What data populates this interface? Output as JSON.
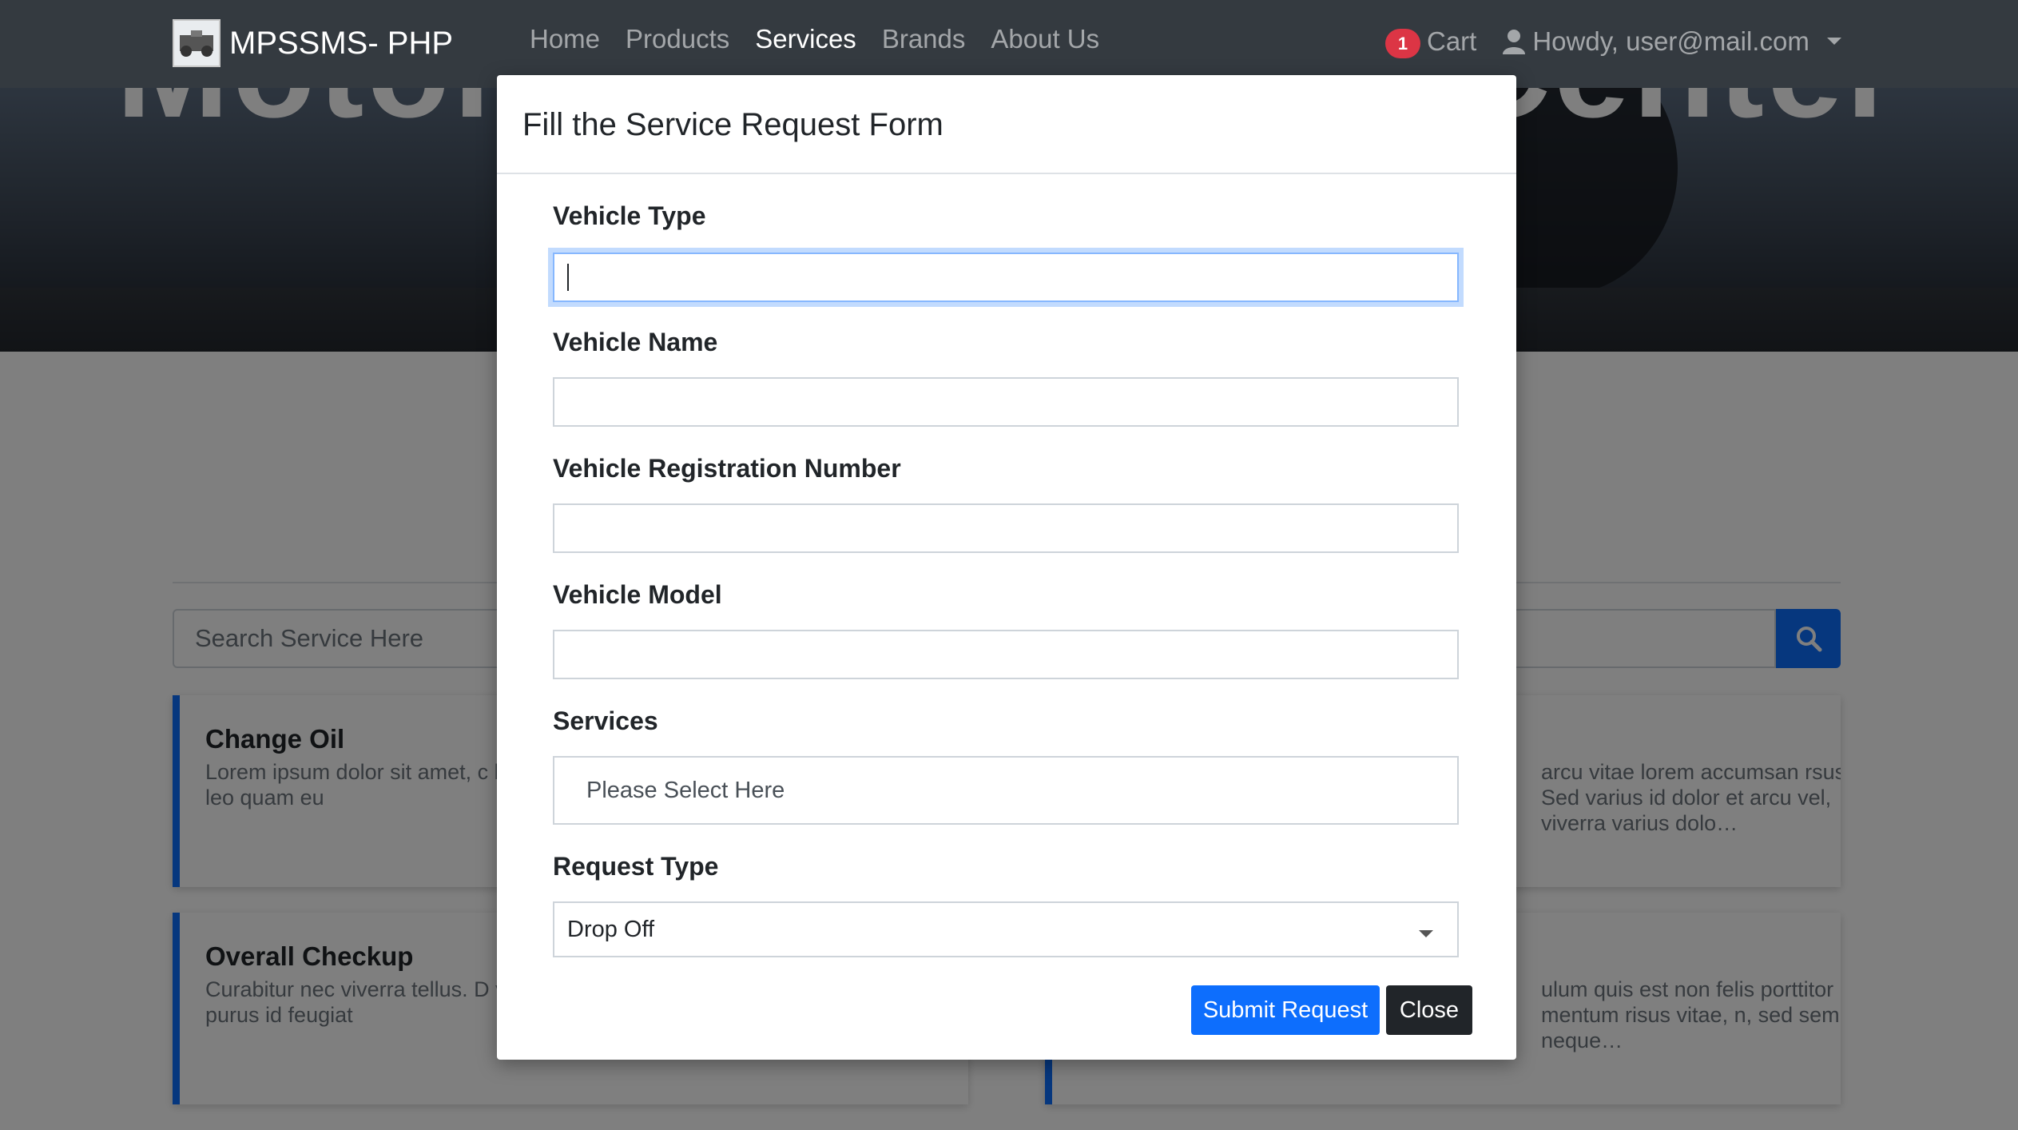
{
  "navbar": {
    "brand": "MPSSMS- PHP",
    "links": [
      "Home",
      "Products",
      "Services",
      "Brands",
      "About Us"
    ],
    "active_link": "Services",
    "cart_count": "1",
    "cart_label": "Cart",
    "user_label": "Howdy, user@mail.com"
  },
  "hero": {
    "title": "Motorcycle Service Center"
  },
  "search": {
    "placeholder": "Search Service Here"
  },
  "cards": [
    {
      "title": "Change Oil",
      "text": "Lorem ipsum dolor sit amet, c lectus. Ut posuere, arcu eget diam, in viverra leo quam eu"
    },
    {
      "title": "",
      "text": "arcu vitae lorem accumsan rsus. Sed varius id dolor et arcu vel, viverra varius dolo…"
    },
    {
      "title": "Overall Checkup",
      "text": "Curabitur nec viverra tellus. D vel vehicula tortor. Vivamus fr iaculis ornare purus id feugiat"
    },
    {
      "title": "",
      "text": "ulum quis est non felis porttitor mentum risus vitae, n, sed semper neque…"
    }
  ],
  "modal": {
    "title": "Fill the Service Request Form",
    "fields": {
      "vehicle_type": {
        "label": "Vehicle Type",
        "value": ""
      },
      "vehicle_name": {
        "label": "Vehicle Name",
        "value": ""
      },
      "vehicle_reg": {
        "label": "Vehicle Registration Number",
        "value": ""
      },
      "vehicle_model": {
        "label": "Vehicle Model",
        "value": ""
      },
      "services": {
        "label": "Services",
        "placeholder": "Please Select Here"
      },
      "request_type": {
        "label": "Request Type",
        "value": "Drop Off"
      }
    },
    "submit_label": "Submit Request",
    "close_label": "Close"
  },
  "colors": {
    "navbar": "#343a40",
    "primary": "#0d6efd",
    "danger": "#dc3545",
    "dark": "#212529"
  }
}
